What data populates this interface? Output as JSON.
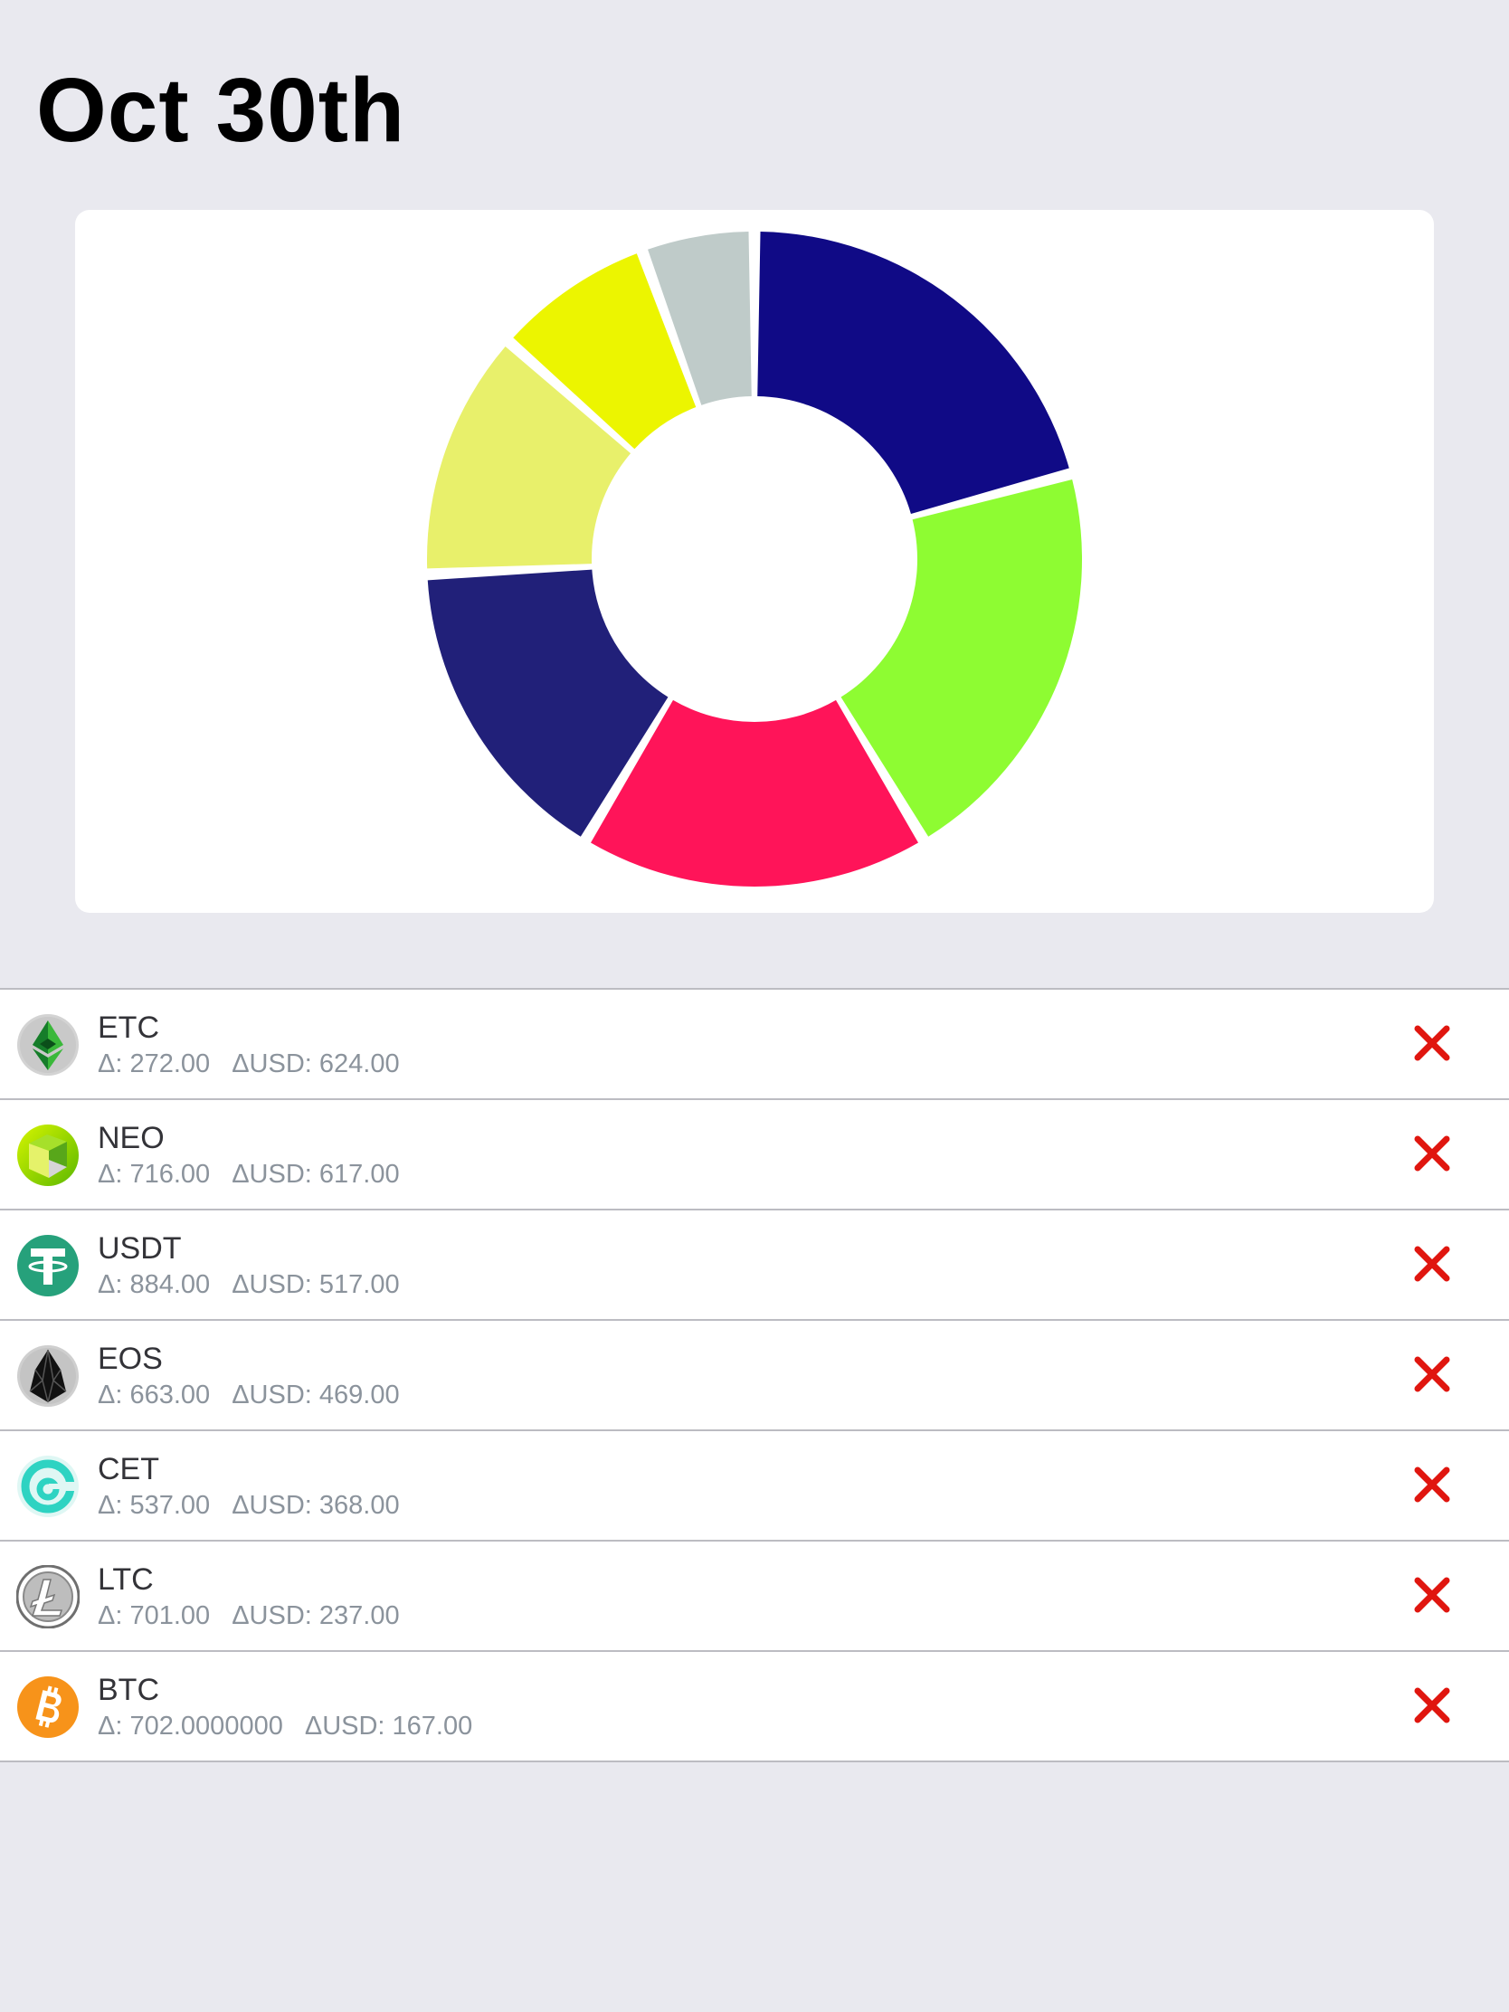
{
  "header": {
    "title": "Oct 30th"
  },
  "colors": {
    "background": "#e9e9ef",
    "card": "#ffffff",
    "delete": "#e0160f",
    "stats_text": "#8b939c"
  },
  "chart_data": {
    "type": "pie",
    "donut": true,
    "title": "",
    "slices": [
      {
        "value": 624,
        "color": "#100a86"
      },
      {
        "value": 617,
        "color": "#8efc32"
      },
      {
        "value": 517,
        "color": "#ff1459"
      },
      {
        "value": 469,
        "color": "#212079"
      },
      {
        "value": 368,
        "color": "#e8f06b"
      },
      {
        "value": 237,
        "color": "#ecf500"
      },
      {
        "value": 167,
        "color": "#bfcbc9"
      }
    ]
  },
  "coins": [
    {
      "symbol": "ETC",
      "delta_label": "Δ: 272.00",
      "usd_label": "ΔUSD: 624.00",
      "icon": "etc-icon"
    },
    {
      "symbol": "NEO",
      "delta_label": "Δ: 716.00",
      "usd_label": "ΔUSD: 617.00",
      "icon": "neo-icon"
    },
    {
      "symbol": "USDT",
      "delta_label": "Δ: 884.00",
      "usd_label": "ΔUSD: 517.00",
      "icon": "usdt-icon"
    },
    {
      "symbol": "EOS",
      "delta_label": "Δ: 663.00",
      "usd_label": "ΔUSD: 469.00",
      "icon": "eos-icon"
    },
    {
      "symbol": "CET",
      "delta_label": "Δ: 537.00",
      "usd_label": "ΔUSD: 368.00",
      "icon": "cet-icon"
    },
    {
      "symbol": "LTC",
      "delta_label": "Δ: 701.00",
      "usd_label": "ΔUSD: 237.00",
      "icon": "ltc-icon"
    },
    {
      "symbol": "BTC",
      "delta_label": "Δ: 702.0000000",
      "usd_label": "ΔUSD: 167.00",
      "icon": "btc-icon"
    }
  ]
}
